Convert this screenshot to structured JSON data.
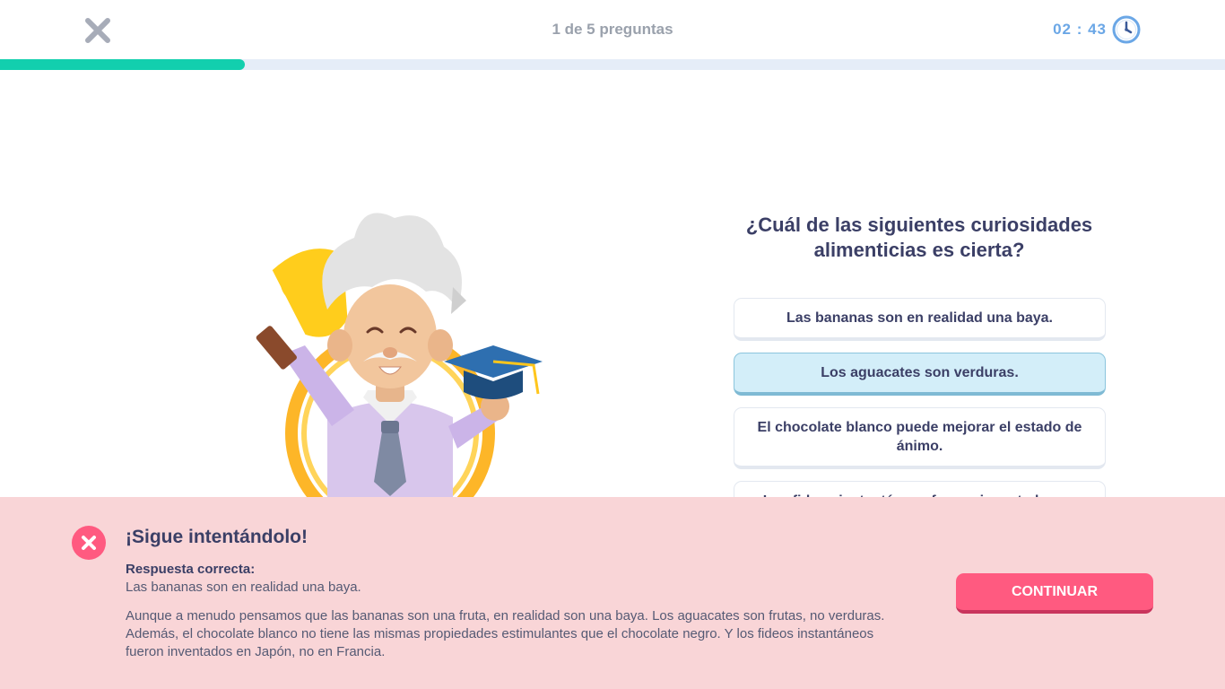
{
  "header": {
    "close_icon": "close-icon",
    "question_counter": "1 de 5 preguntas",
    "timer": "02 : 43",
    "timer_icon": "clock-icon",
    "progress_fraction": 0.2,
    "colors": {
      "progress": "#12cfae",
      "track": "#e5edf8",
      "timer": "#6ba7e6"
    }
  },
  "quiz": {
    "question": "¿Cuál de las siguientes curiosidades alimenticias es cierta?",
    "options": [
      {
        "label": "Las bananas son en realidad una baya.",
        "selected": false
      },
      {
        "label": "Los aguacates son verduras.",
        "selected": true
      },
      {
        "label": "El chocolate blanco puede mejorar el estado de ánimo.",
        "selected": false
      },
      {
        "label": "Los fideos instantáneos fueron inventados en",
        "selected": false
      }
    ]
  },
  "feedback": {
    "icon": "wrong-icon",
    "title": "¡Sigue intentándolo!",
    "correct_label": "Respuesta correcta:",
    "correct_answer": "Las bananas son en realidad una baya.",
    "explanation": "Aunque a menudo pensamos que las bananas son una fruta, en realidad son una baya. Los aguacates son frutas, no verduras. Además, el chocolate blanco no tiene las mismas propiedades estimulantes que el chocolate negro. Y los fideos instantáneos fueron inventados en Japón, no en Francia.",
    "continue_label": "CONTINUAR",
    "colors": {
      "background": "#f9d5d7",
      "button": "#ff5a80"
    }
  }
}
